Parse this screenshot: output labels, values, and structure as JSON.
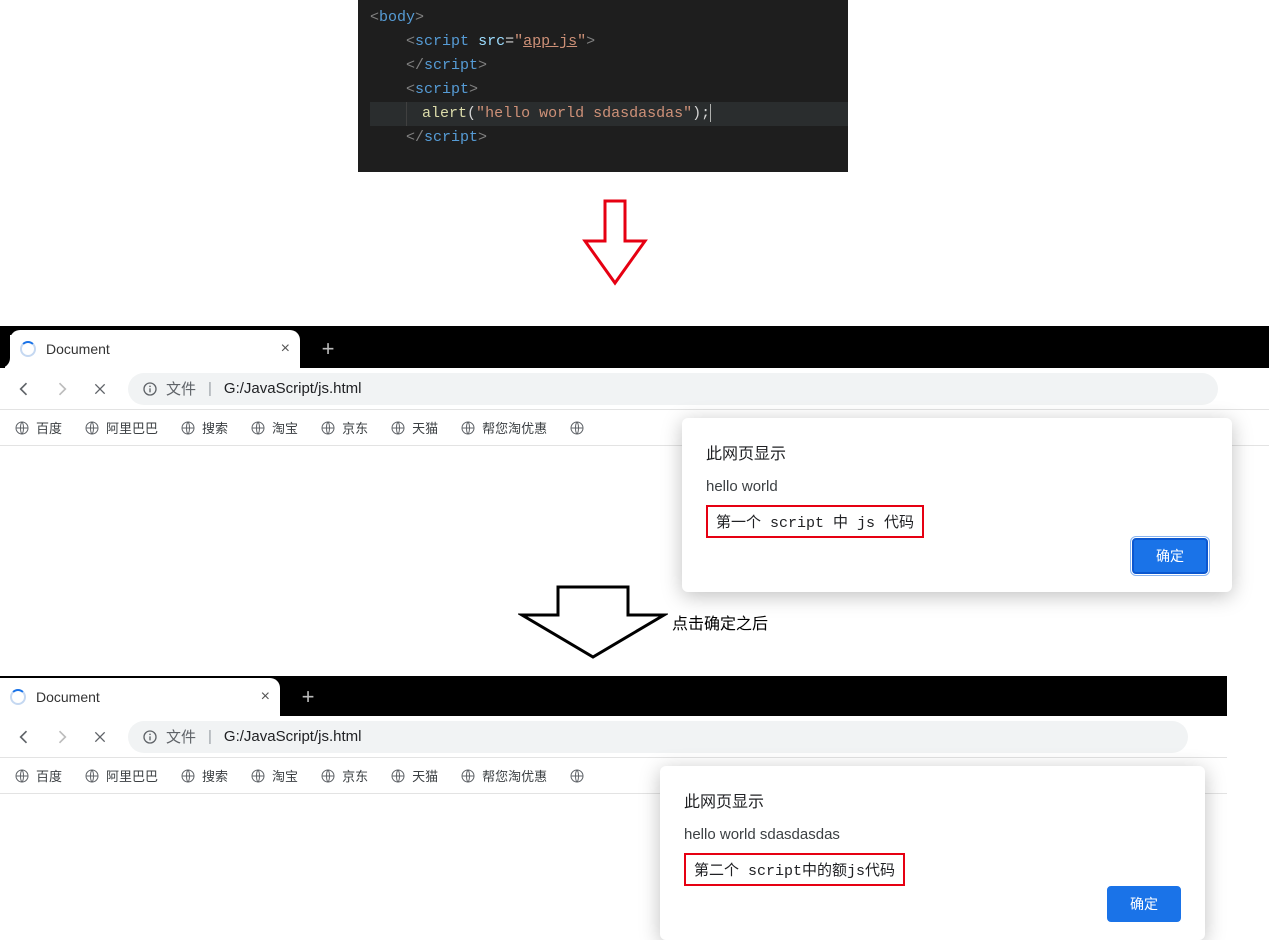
{
  "code": {
    "l1": {
      "open": "<",
      "tag": "body",
      "close": ">"
    },
    "l2": {
      "open": "<",
      "tag": "script",
      "sp": " ",
      "attr": "src",
      "eq": "=",
      "q1": "\"",
      "str": "app.js",
      "q2": "\"",
      "close": ">"
    },
    "l3": {
      "open": "</",
      "tag": "script",
      "close": ">"
    },
    "l4": {
      "open": "<",
      "tag": "script",
      "close": ">"
    },
    "l5": {
      "fn": "alert",
      "p1": "(",
      "q1": "\"",
      "str": "hello world sdasdasdas",
      "q2": "\"",
      "p2": ")",
      "semi": ";"
    },
    "l6": {
      "open": "</",
      "tag": "script",
      "close": ">"
    }
  },
  "browser1": {
    "tab_title": "Document",
    "url_label": "文件",
    "url_path": "G:/JavaScript/js.html",
    "bookmarks": [
      "百度",
      "阿里巴巴",
      "搜索",
      "淘宝",
      "京东",
      "天猫",
      "帮您淘优惠"
    ],
    "dialog": {
      "title": "此网页显示",
      "message": "hello world",
      "note": "第一个 script 中 js 代码",
      "ok": "确定"
    }
  },
  "arrow_caption": "点击确定之后",
  "browser2": {
    "tab_title": "Document",
    "url_label": "文件",
    "url_path": "G:/JavaScript/js.html",
    "bookmarks": [
      "百度",
      "阿里巴巴",
      "搜索",
      "淘宝",
      "京东",
      "天猫",
      "帮您淘优惠"
    ],
    "dialog": {
      "title": "此网页显示",
      "message": "hello world sdasdasdas",
      "note": "第二个 script中的额js代码",
      "ok": "确定"
    }
  }
}
